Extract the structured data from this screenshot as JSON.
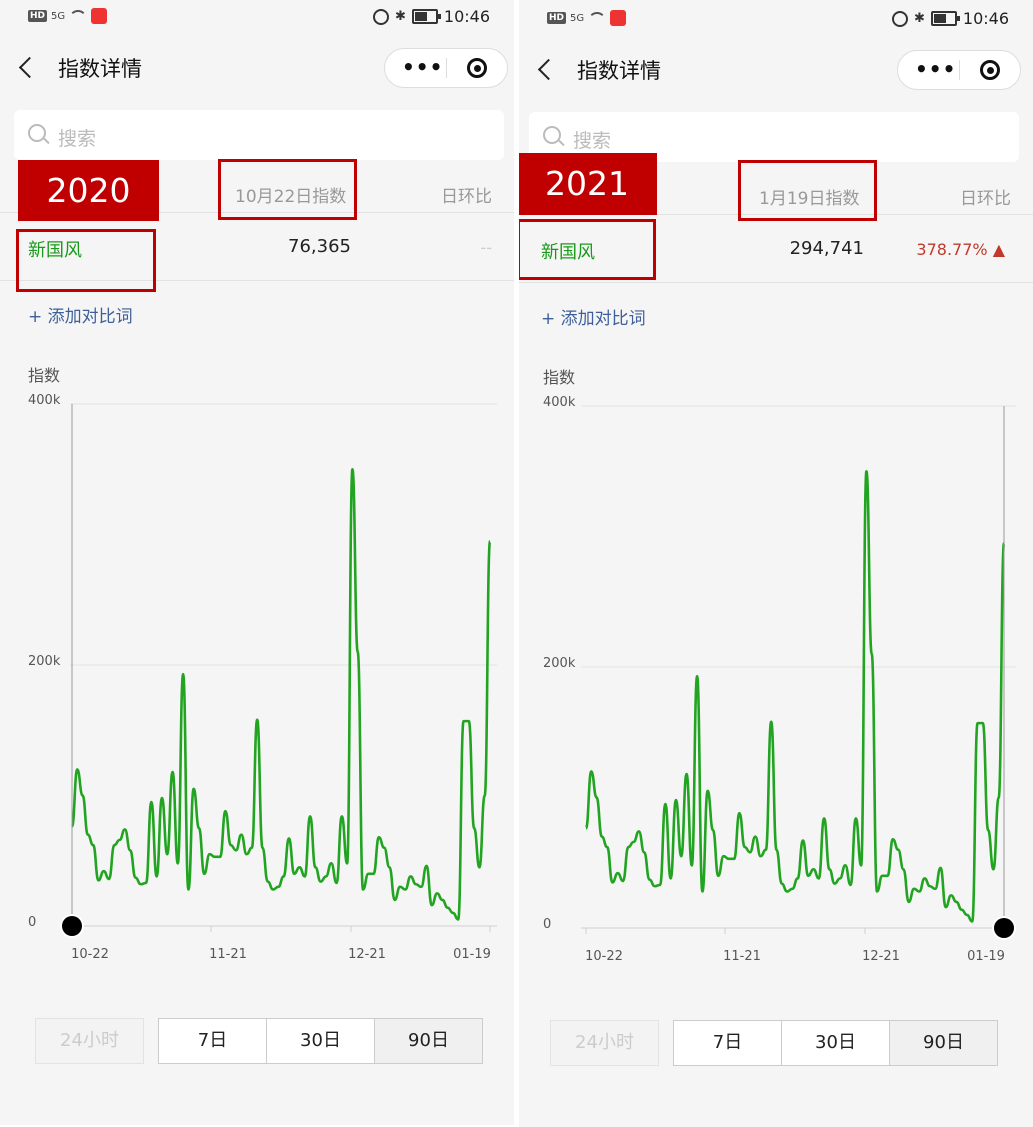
{
  "panels": [
    {
      "status": {
        "time": "10:46",
        "net": "HD",
        "signal": "5G"
      },
      "nav": {
        "title": "指数详情",
        "more": "•••"
      },
      "search": {
        "placeholder": "搜索"
      },
      "badge": "2020",
      "header": {
        "index_label": "10月22日指数",
        "dod_label": "日环比"
      },
      "row": {
        "keyword": "新国风",
        "value": "76,365",
        "change": "--"
      },
      "add_label": "+ 添加对比词",
      "chart_data": {
        "type": "line",
        "ylabel": "指数",
        "y_ticks": [
          "400k",
          "200k",
          "0"
        ],
        "x_ticks": [
          "10-22",
          "11-21",
          "12-21",
          "01-19"
        ],
        "ylim": [
          0,
          400000
        ],
        "series": [
          {
            "values": [
              76365,
              120000,
              100000,
              70000,
              62000,
              35000,
              42000,
              36000,
              62000,
              66000,
              74000,
              58000,
              37000,
              32000,
              33000,
              95000,
              38000,
              98000,
              55000,
              118000,
              48000,
              193000,
              28000,
              105000,
              75000,
              40000,
              55000,
              53000,
              53000,
              88000,
              62000,
              58000,
              70000,
              55000,
              60000,
              158000,
              60000,
              34000,
              28000,
              30000,
              38000,
              67000,
              40000,
              45000,
              38000,
              84000,
              45000,
              34000,
              38000,
              48000,
              33000,
              84000,
              48000,
              350000,
              210000,
              28000,
              40000,
              40000,
              68000,
              60000,
              45000,
              20000,
              30000,
              28000,
              38000,
              32000,
              30000,
              46000,
              16000,
              25000,
              20000,
              14000,
              10000,
              5000,
              157000,
              157000,
              75000,
              45000,
              100000,
              294741
            ]
          }
        ]
      },
      "tabs": {
        "h24": "24小时",
        "d7": "7日",
        "d30": "30日",
        "d90": "90日"
      }
    },
    {
      "status": {
        "time": "10:46",
        "net": "HD",
        "signal": "5G"
      },
      "nav": {
        "title": "指数详情",
        "more": "•••"
      },
      "search": {
        "placeholder": "搜索"
      },
      "badge": "2021",
      "header": {
        "index_label": "1月19日指数",
        "dod_label": "日环比"
      },
      "row": {
        "keyword": "新国风",
        "value": "294,741",
        "change": "378.77% ▲"
      },
      "add_label": "+ 添加对比词",
      "chart_data": {
        "type": "line",
        "ylabel": "指数",
        "y_ticks": [
          "400k",
          "200k",
          "0"
        ],
        "x_ticks": [
          "10-22",
          "11-21",
          "12-21",
          "01-19"
        ],
        "ylim": [
          0,
          400000
        ],
        "series": [
          {
            "values": [
              76365,
              120000,
              100000,
              70000,
              62000,
              35000,
              42000,
              36000,
              62000,
              66000,
              74000,
              58000,
              37000,
              32000,
              33000,
              95000,
              38000,
              98000,
              55000,
              118000,
              48000,
              193000,
              28000,
              105000,
              75000,
              40000,
              55000,
              53000,
              53000,
              88000,
              62000,
              58000,
              70000,
              55000,
              60000,
              158000,
              60000,
              34000,
              28000,
              30000,
              38000,
              67000,
              40000,
              45000,
              38000,
              84000,
              45000,
              34000,
              38000,
              48000,
              33000,
              84000,
              48000,
              350000,
              210000,
              28000,
              40000,
              40000,
              68000,
              60000,
              45000,
              20000,
              30000,
              28000,
              38000,
              32000,
              30000,
              46000,
              16000,
              25000,
              20000,
              14000,
              10000,
              5000,
              157000,
              157000,
              75000,
              45000,
              100000,
              294741
            ]
          }
        ]
      },
      "tabs": {
        "h24": "24小时",
        "d7": "7日",
        "d30": "30日",
        "d90": "90日"
      }
    }
  ],
  "colors": {
    "line": "#22a422",
    "highlight": "#c00000",
    "keyword": "#1a9a1a",
    "up": "#c0392b"
  }
}
